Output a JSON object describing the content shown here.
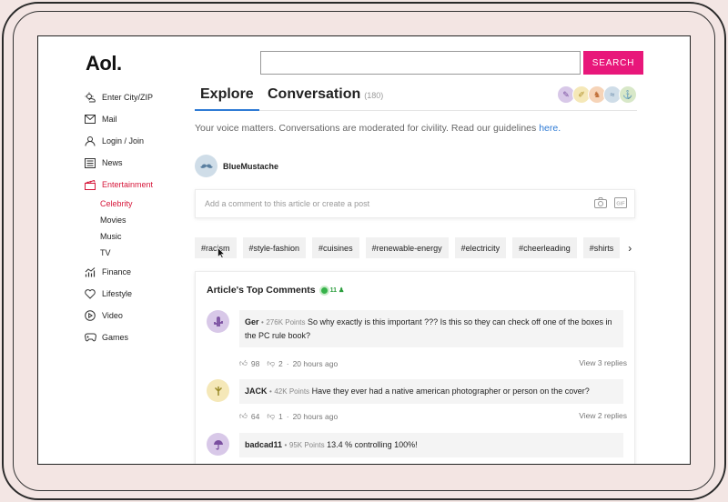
{
  "logo": "Aol.",
  "search": {
    "placeholder": "",
    "button": "SEARCH"
  },
  "nav": {
    "items": [
      {
        "label": "Enter City/ZIP",
        "icon": "weather-icon"
      },
      {
        "label": "Mail",
        "icon": "mail-icon"
      },
      {
        "label": "Login / Join",
        "icon": "user-icon"
      },
      {
        "label": "News",
        "icon": "news-icon"
      },
      {
        "label": "Entertainment",
        "icon": "entertainment-icon"
      }
    ],
    "sub": [
      "Celebrity",
      "Movies",
      "Music",
      "TV"
    ],
    "items2": [
      {
        "label": "Finance",
        "icon": "finance-icon"
      },
      {
        "label": "Lifestyle",
        "icon": "heart-icon"
      },
      {
        "label": "Video",
        "icon": "play-icon"
      },
      {
        "label": "Games",
        "icon": "gamepad-icon"
      }
    ]
  },
  "tabs": {
    "explore": "Explore",
    "conversation": "Conversation",
    "count": "(180)"
  },
  "voice": {
    "text": "Your voice matters. Conversations are moderated for civility. Read our guidelines ",
    "link": "here."
  },
  "user": {
    "name": "BlueMustache"
  },
  "comment_box": {
    "placeholder": "Add a comment to this article or create a post"
  },
  "tags": [
    "#racism",
    "#style-fashion",
    "#cuisines",
    "#renewable-energy",
    "#electricity",
    "#cheerleading",
    "#shirts"
  ],
  "top_comments": {
    "title": "Article's Top Comments",
    "live_count": "11",
    "comments": [
      {
        "author": "Ger",
        "points": "276K Points",
        "text": "So why exactly is this important ??? Is this so they can check off one of the boxes in the PC rule book?",
        "likes": "98",
        "dislikes": "2",
        "time": "20 hours ago",
        "replies": "View 3 replies"
      },
      {
        "author": "JACK",
        "points": "42K Points",
        "text": "Have they ever had a native american photographer or person on the cover?",
        "likes": "64",
        "dislikes": "1",
        "time": "20 hours ago",
        "replies": "View 2 replies"
      },
      {
        "author": "badcad11",
        "points": "95K Points",
        "text": "13.4 % controlling 100%!",
        "likes": "",
        "dislikes": "",
        "time": "",
        "replies": ""
      }
    ]
  },
  "colors": {
    "accent": "#e8177a",
    "link": "#2f7bd5",
    "active": "#d6173a"
  }
}
